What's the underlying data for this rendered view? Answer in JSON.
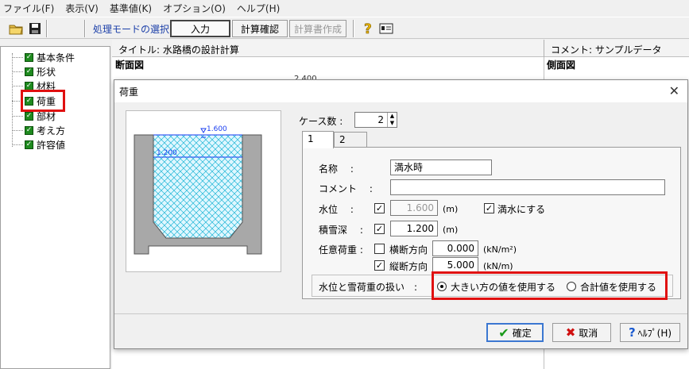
{
  "menu": [
    "ファイル(F)",
    "表示(V)",
    "基準値(K)",
    "オプション(O)",
    "ヘルプ(H)"
  ],
  "toolbar": {
    "mode_label": "処理モードの選択",
    "input_label": "入力",
    "calc_check_label": "計算確認",
    "report_label": "計算書作成"
  },
  "tree": {
    "items": [
      {
        "label": "基本条件",
        "checked": true
      },
      {
        "label": "形状",
        "checked": true
      },
      {
        "label": "材料",
        "checked": true
      },
      {
        "label": "荷重",
        "checked": true
      },
      {
        "label": "部材",
        "checked": true
      },
      {
        "label": "考え方",
        "checked": true
      },
      {
        "label": "許容値",
        "checked": true
      }
    ]
  },
  "header": {
    "title": "タイトル: 水路橋の設計計算",
    "comment": "コメント: サンプルデータ",
    "section_left": "断面図",
    "section_right": "側面図",
    "top_dimension": "2,400"
  },
  "dialog": {
    "title": "荷重",
    "preview": {
      "water_level": "1.600",
      "snow_depth": "1.200"
    },
    "case_count_label": "ケース数 :",
    "case_count": "2",
    "tabs": [
      "1",
      "2"
    ],
    "fields": {
      "name_label": "名称　 :",
      "name_value": "満水時",
      "comment_label": "コメント　 :",
      "comment_value": "",
      "water_level_label": "水位　 :",
      "water_level_value": "1.600",
      "water_level_unit": "(m)",
      "full_water_label": "満水にする",
      "snow_label": "積雪深　 :",
      "snow_value": "1.200",
      "snow_unit": "(m)",
      "optional_load_label": "任意荷重 :",
      "transverse_label": "横断方向",
      "transverse_value": "0.000",
      "transverse_unit": "(kN/m²)",
      "longitudinal_label": "縦断方向",
      "longitudinal_value": "5.000",
      "longitudinal_unit": "(kN/m)"
    },
    "handling": {
      "label": "水位と雪荷重の扱い　:",
      "option_max": "大きい方の値を使用する",
      "option_sum": "合計値を使用する"
    },
    "buttons": {
      "ok": "確定",
      "cancel": "取消",
      "help": "ﾍﾙﾌﾟ(H)"
    }
  },
  "colors": {
    "highlight_red": "#e01010",
    "mode_blue": "#1a3ea8",
    "check_green": "#1f8a1f"
  }
}
